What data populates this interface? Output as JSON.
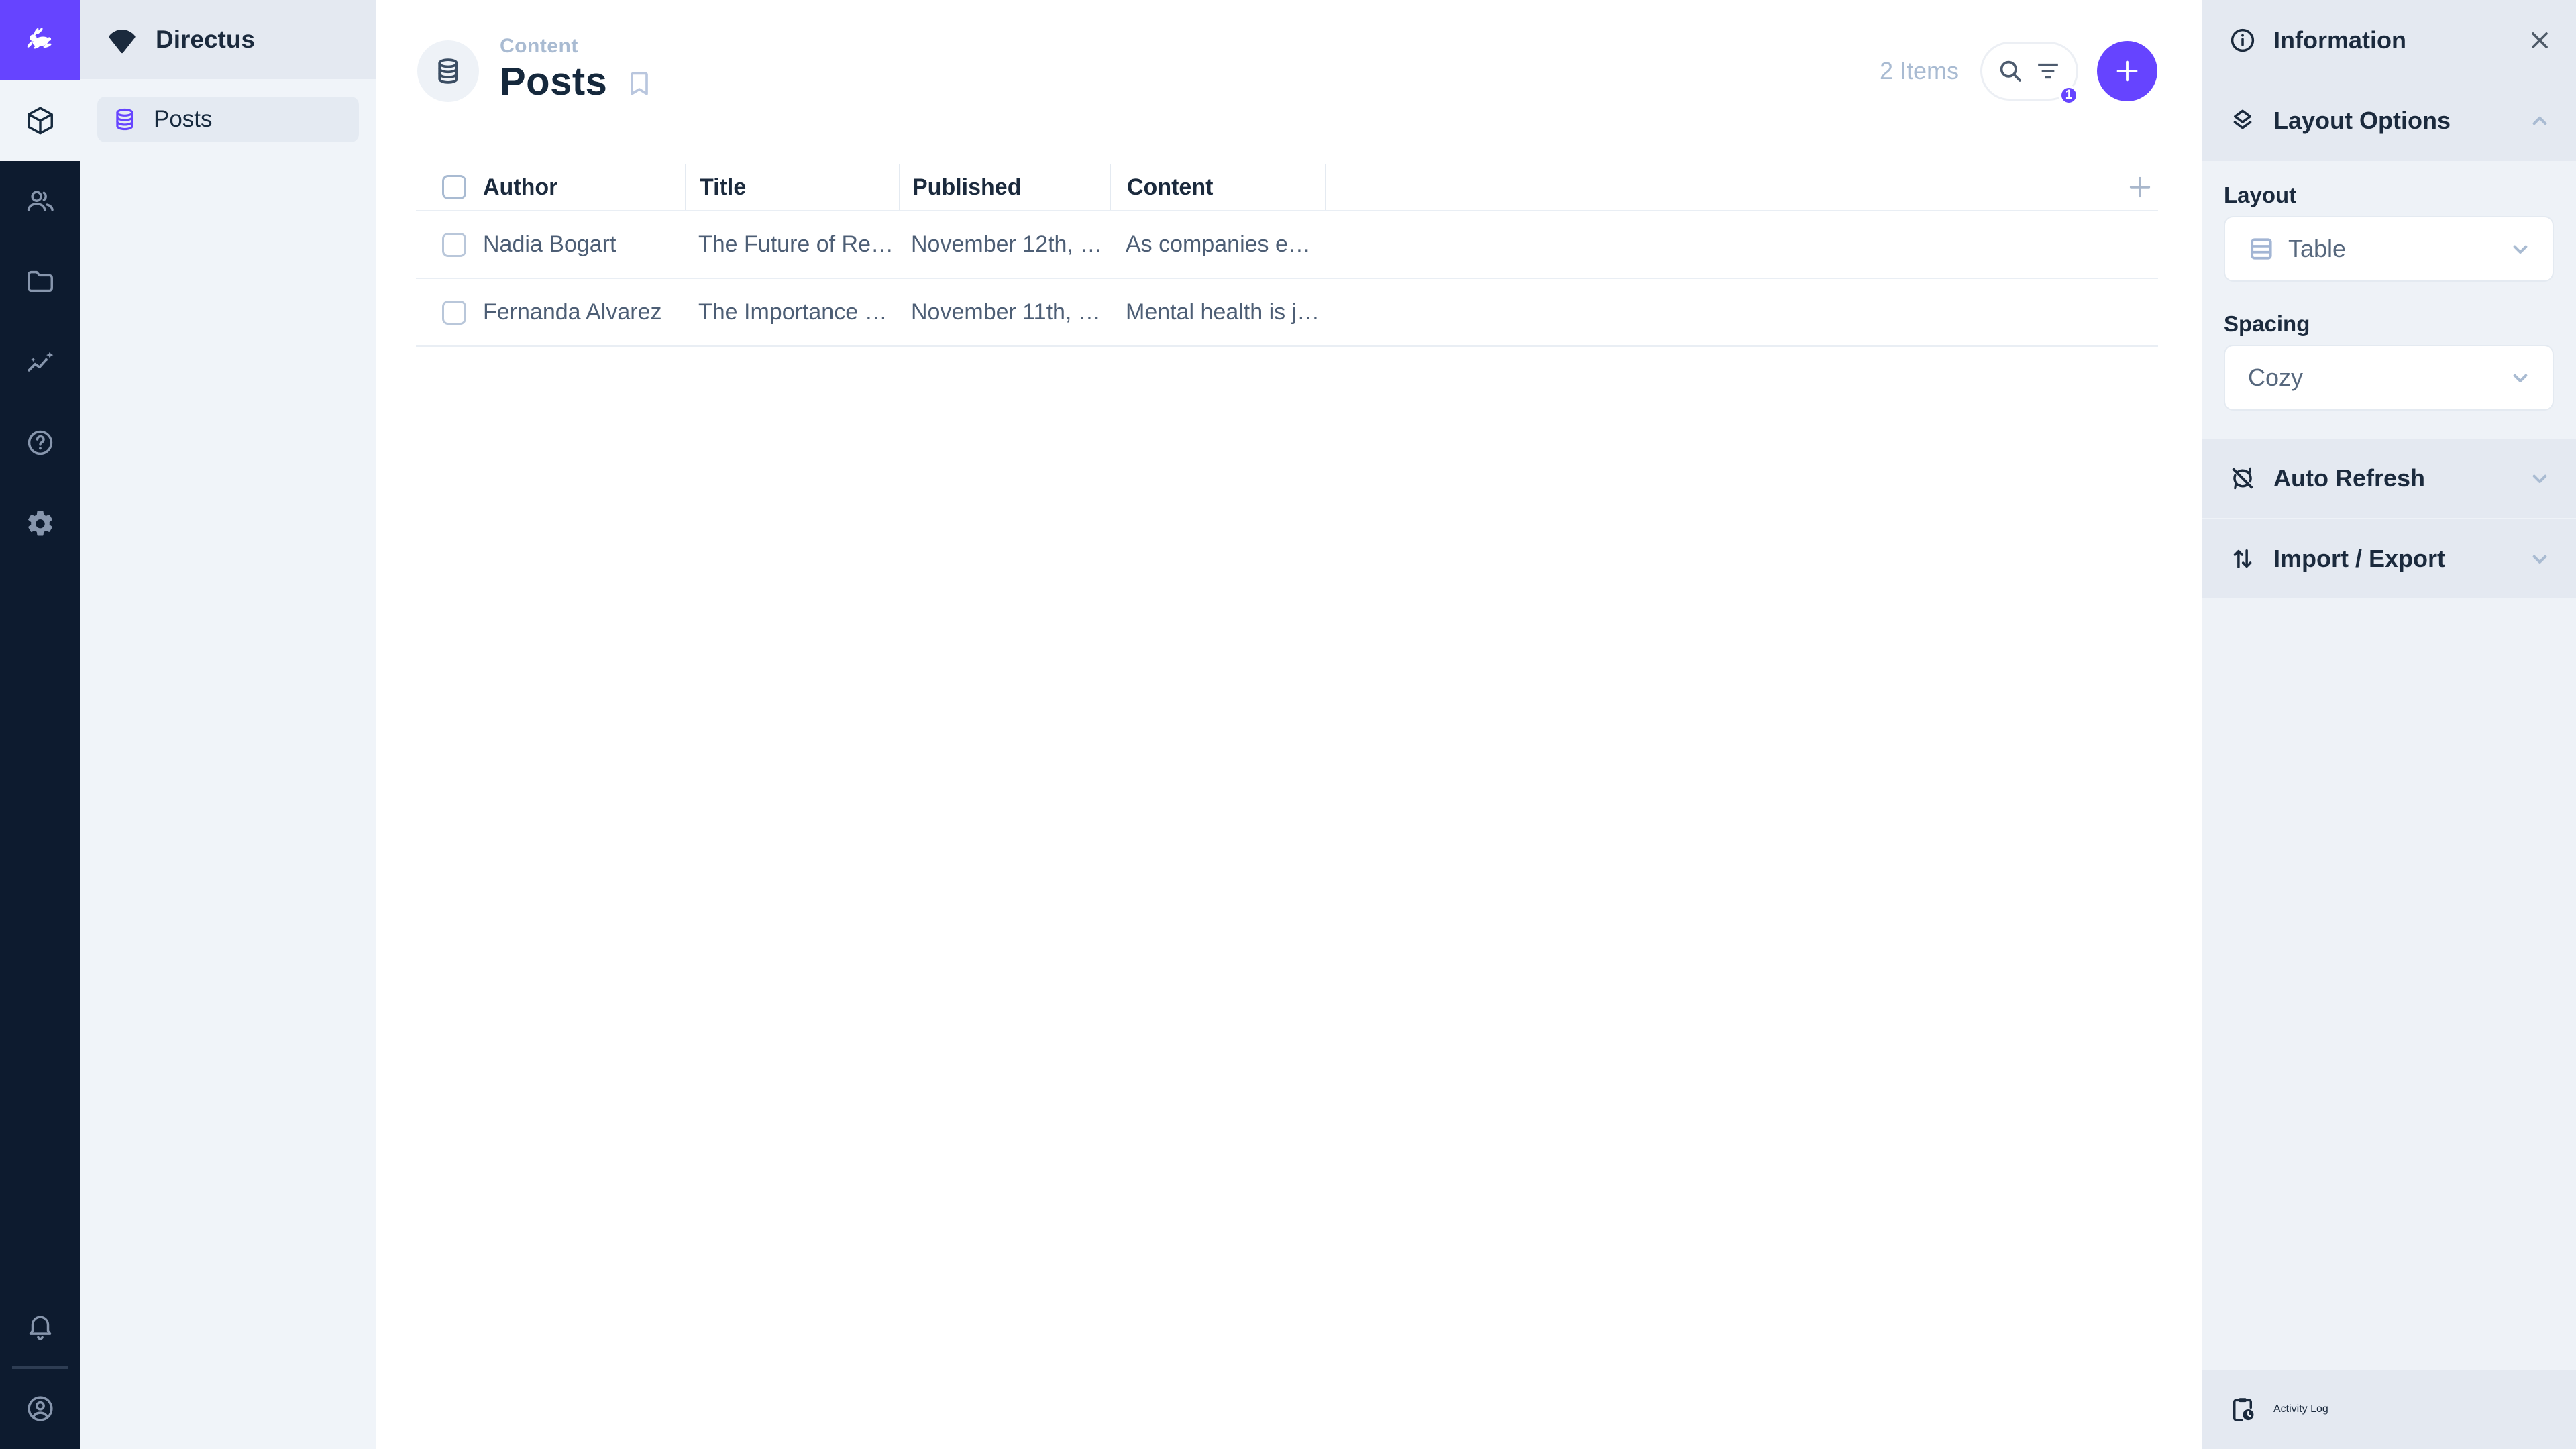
{
  "brand": {
    "name": "Directus"
  },
  "colors": {
    "accent": "#6644ff",
    "module_bar_bg": "#0d1b2f",
    "surface": "#f0f4f9",
    "section_bg": "#e4e9f1",
    "text_primary": "#1b2a3d",
    "text_secondary": "#4d5e75",
    "text_muted": "#a9bbd2",
    "border": "#e4eaf1"
  },
  "icons": {
    "logo": "directus-rabbit",
    "project": "fan-wedge",
    "modules": [
      "content-cube",
      "users-group",
      "files-folder",
      "insights-chart",
      "help-question",
      "settings-gear"
    ],
    "module_bottom": [
      "notifications-bell",
      "account-circle"
    ],
    "collection": "database-cylinder",
    "header": [
      "bookmark",
      "search-magnifier",
      "filter-bars",
      "plus"
    ],
    "sidebar": [
      "info-circle",
      "close-x",
      "layers",
      "chevron-up",
      "chevron-down",
      "sync-disabled",
      "swap-vertical",
      "clipboard-clock"
    ],
    "layout_select": "table-grid"
  },
  "nav": {
    "project_name": "Directus",
    "items": [
      {
        "label": "Posts",
        "active": true
      }
    ]
  },
  "page_header": {
    "breadcrumb": "Content",
    "title": "Posts",
    "item_count": "2 Items",
    "filter_badge_count": "1"
  },
  "table": {
    "columns": [
      {
        "label": "Author"
      },
      {
        "label": "Title"
      },
      {
        "label": "Published"
      },
      {
        "label": "Content"
      }
    ],
    "rows": [
      {
        "author": "Nadia Bogart",
        "title": "The Future of Re…",
        "published": "November 12th, …",
        "content": "As companies e…"
      },
      {
        "author": "Fernanda Alvarez",
        "title": "The Importance …",
        "published": "November 11th, …",
        "content": "Mental health is j…"
      }
    ]
  },
  "sidebar": {
    "header": {
      "title": "Information"
    },
    "sections": [
      {
        "label": "Layout Options",
        "state": "expanded"
      },
      {
        "label": "Auto Refresh",
        "state": "collapsed"
      },
      {
        "label": "Import / Export",
        "state": "collapsed"
      }
    ],
    "layout_options": {
      "layout_label": "Layout",
      "layout_value": "Table",
      "spacing_label": "Spacing",
      "spacing_value": "Cozy"
    },
    "footer": {
      "label": "Activity Log"
    }
  }
}
